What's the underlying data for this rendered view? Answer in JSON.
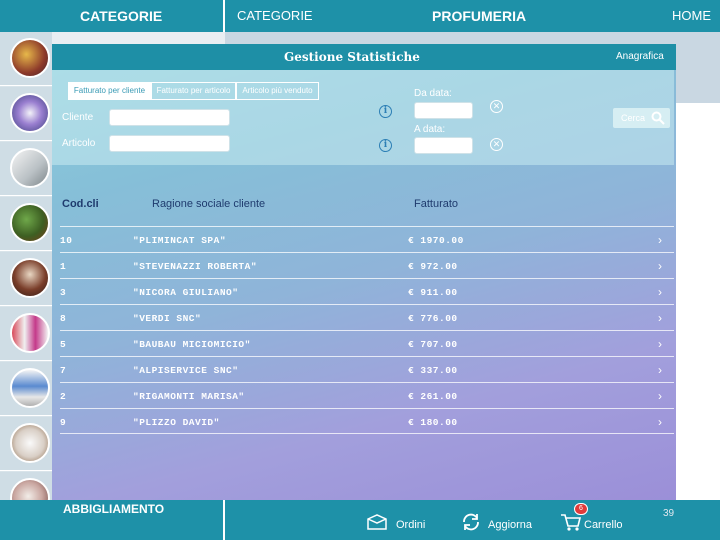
{
  "topbar": {
    "left_label": "CATEGORIE",
    "mid_label": "CATEGORIE",
    "title": "PROFUMERIA",
    "home_label": "HOME"
  },
  "sidebar": {
    "categories": [
      {
        "icon": "perfume-bottles-icon"
      },
      {
        "icon": "makeup-compact-icon"
      },
      {
        "icon": "appliance-icon"
      },
      {
        "icon": "vegetables-icon"
      },
      {
        "icon": "wine-glass-icon"
      },
      {
        "icon": "bottles-icon"
      },
      {
        "icon": "shelf-products-icon"
      },
      {
        "icon": "glasses-icon"
      },
      {
        "icon": "clothing-icon"
      }
    ],
    "bottom_label": "ABBIGLIAMENTO"
  },
  "panel": {
    "title": "Gestione Statistiche",
    "anagrafica": "Anagrafica",
    "tabs": [
      {
        "label": "Fatturato per cliente",
        "active": true
      },
      {
        "label": "Fatturato per articolo",
        "active": false
      },
      {
        "label": "Articolo più venduto",
        "active": false
      }
    ],
    "cliente_label": "Cliente",
    "articolo_label": "Articolo",
    "da_data_label": "Da data:",
    "a_data_label": "A data:",
    "cerca_label": "Cerca"
  },
  "table": {
    "headers": {
      "code": "Cod.cli",
      "name": "Ragione sociale cliente",
      "revenue": "Fatturato"
    },
    "rows": [
      {
        "code": "10",
        "name": "\"PLIMINCAT SPA\"",
        "revenue": "€ 1970.00"
      },
      {
        "code": "1",
        "name": "\"STEVENAZZI ROBERTA\"",
        "revenue": "€ 972.00"
      },
      {
        "code": "3",
        "name": "\"NICORA GIULIANO\"",
        "revenue": "€ 911.00"
      },
      {
        "code": "8",
        "name": "\"VERDI SNC\"",
        "revenue": "€ 776.00"
      },
      {
        "code": "5",
        "name": "\"BAUBAU MICIOMICIO\"",
        "revenue": "€ 707.00"
      },
      {
        "code": "7",
        "name": "\"ALPISERVICE SNC\"",
        "revenue": "€ 337.00"
      },
      {
        "code": "2",
        "name": "\"RIGAMONTI MARISA\"",
        "revenue": "€ 261.00"
      },
      {
        "code": "9",
        "name": "\"PLIZZO DAVID\"",
        "revenue": "€ 180.00"
      }
    ]
  },
  "bottombar": {
    "ordini": "Ordini",
    "aggiorna": "Aggiorna",
    "carrello": "Carrello",
    "cart_count": "6",
    "page_number": "39"
  },
  "colors": {
    "accent": "#1e91a8",
    "badge": "#e03b3b",
    "header_text": "#1f3b6e"
  }
}
